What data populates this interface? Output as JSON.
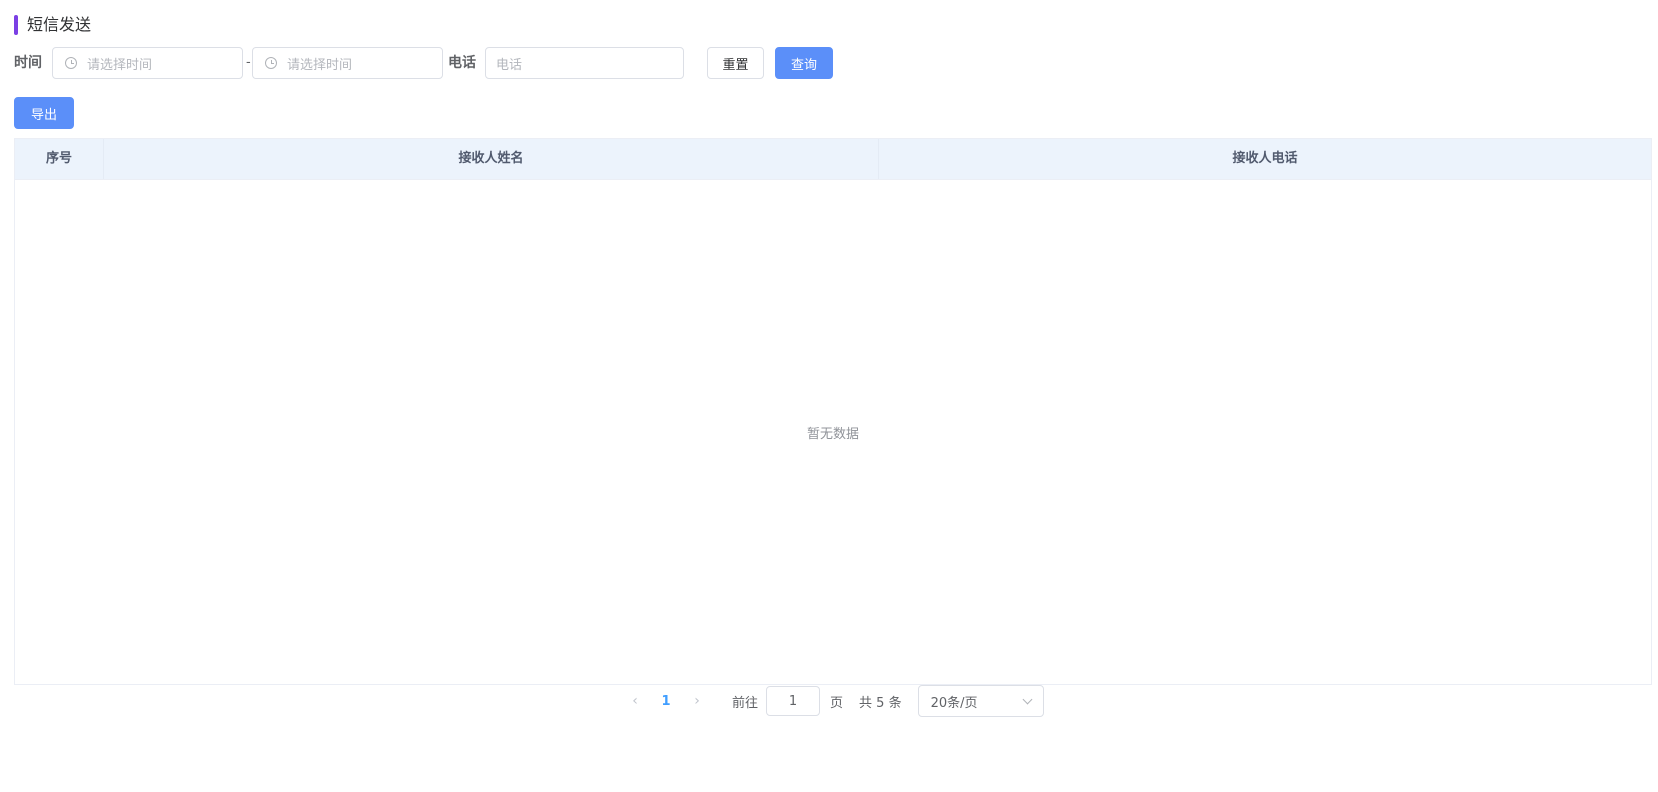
{
  "page": {
    "title": "短信发送"
  },
  "filters": {
    "time_label": "时间",
    "start_placeholder": "请选择时间",
    "range_separator": "-",
    "end_placeholder": "请选择时间",
    "phone_label": "电话",
    "phone_placeholder": "电话",
    "reset_label": "重置",
    "search_label": "查询"
  },
  "toolbar": {
    "export_label": "导出"
  },
  "table": {
    "columns": [
      "序号",
      "接收人姓名",
      "接收人电话"
    ],
    "empty_text": "暂无数据"
  },
  "pagination": {
    "prev_icon": "chevron-left-icon",
    "current_page": "1",
    "next_icon": "chevron-right-icon",
    "goto_label": "前往",
    "goto_value": "1",
    "page_label": "页",
    "total_text": "共 5 条",
    "page_size": "20条/页"
  },
  "colors": {
    "accent": "#7b3fe4",
    "primary": "#5b8ff9",
    "header_bg": "#ecf3fc",
    "active_page": "#409eff"
  }
}
